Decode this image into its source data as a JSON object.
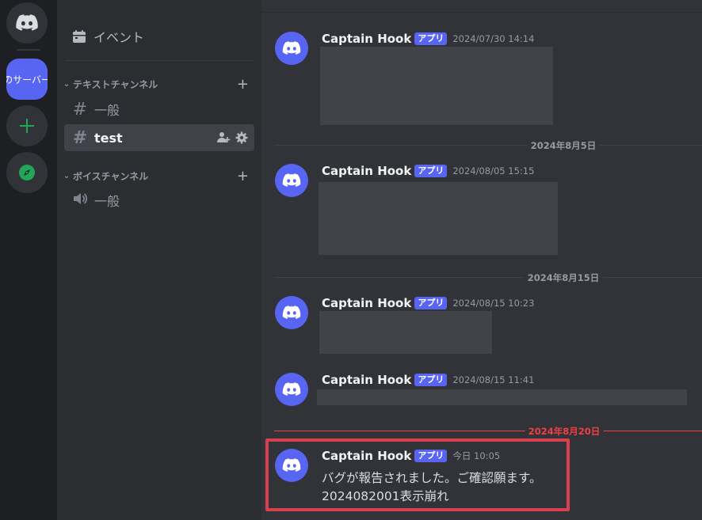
{
  "servers": {
    "active_server_label": "のサーバー"
  },
  "sidebar": {
    "events_label": "イベント",
    "categories": [
      {
        "name": "テキストチャンネル",
        "channels": [
          {
            "name": "一般",
            "type": "text",
            "active": false
          },
          {
            "name": "test",
            "type": "text",
            "active": true
          }
        ]
      },
      {
        "name": "ボイスチャンネル",
        "channels": [
          {
            "name": "一般",
            "type": "voice",
            "active": false
          }
        ]
      }
    ]
  },
  "chat": {
    "date_separators": [
      "2024年8月5日",
      "2024年8月15日",
      "2024年8月20日"
    ],
    "messages": [
      {
        "author": "Captain Hook",
        "tag": "アプリ",
        "timestamp": "2024/07/30 14:14"
      },
      {
        "author": "Captain Hook",
        "tag": "アプリ",
        "timestamp": "2024/08/05 15:15"
      },
      {
        "author": "Captain Hook",
        "tag": "アプリ",
        "timestamp": "2024/08/15 10:23"
      },
      {
        "author": "Captain Hook",
        "tag": "アプリ",
        "timestamp": "2024/08/15 11:41"
      },
      {
        "author": "Captain Hook",
        "tag": "アプリ",
        "timestamp": "今日 10:05",
        "lines": [
          "バグが報告されました。ご確認願ます。",
          "2024082001表示崩れ"
        ]
      }
    ]
  },
  "colors": {
    "blurple": "#5865f2",
    "new_marker": "#f23f43",
    "highlight_box": "#d9404f",
    "green": "#23a55a"
  },
  "icons": [
    "discord-logo-icon",
    "plus-icon",
    "compass-icon",
    "calendar-icon",
    "chevron-down-icon",
    "hash-icon",
    "speaker-icon",
    "add-member-icon",
    "gear-icon"
  ]
}
